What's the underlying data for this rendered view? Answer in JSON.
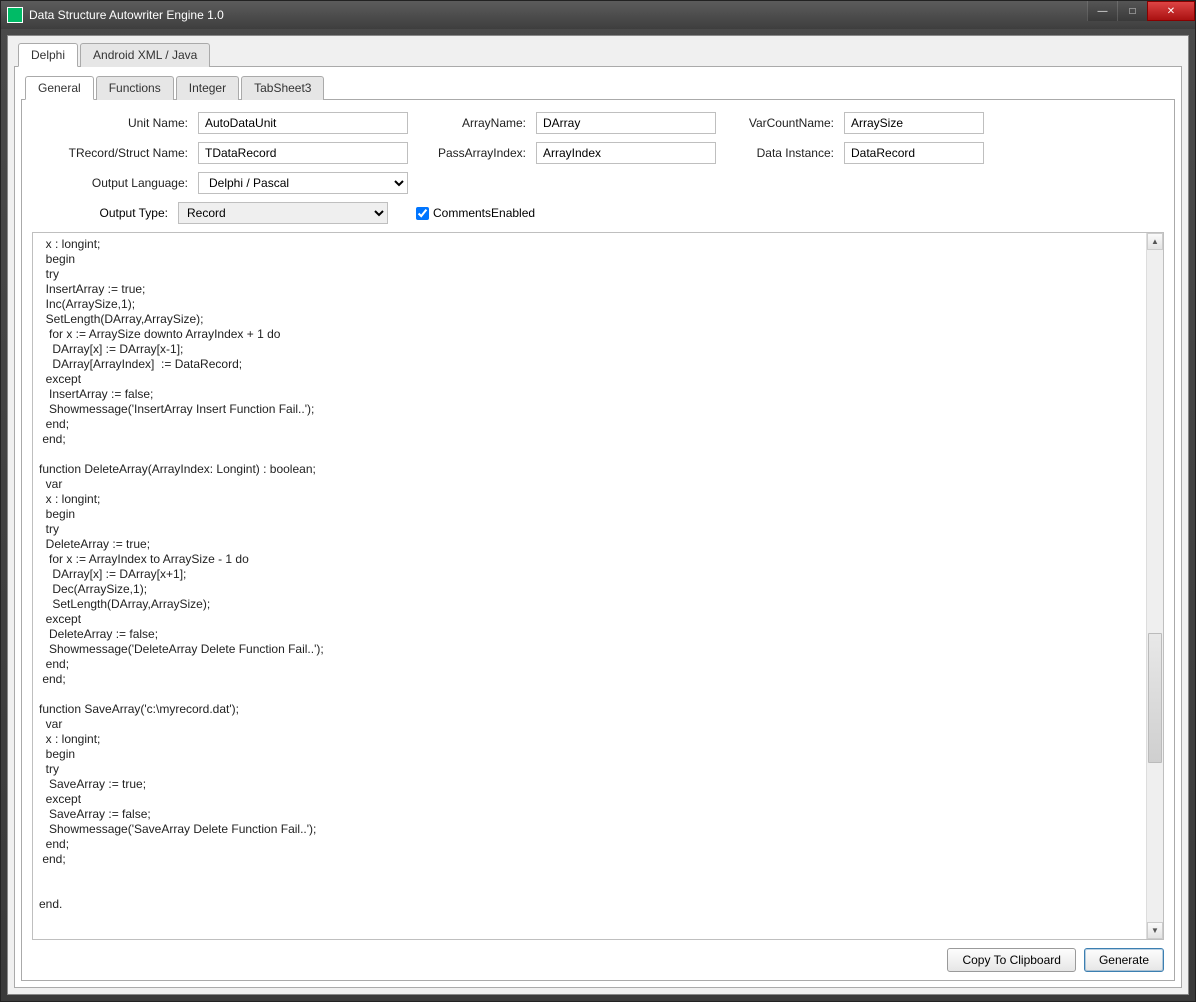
{
  "window": {
    "title": "Data Structure Autowriter Engine 1.0"
  },
  "outerTabs": {
    "delphi": "Delphi",
    "android": "Android XML / Java"
  },
  "innerTabs": {
    "general": "General",
    "functions": "Functions",
    "integer": "Integer",
    "tabsheet3": "TabSheet3"
  },
  "labels": {
    "unitName": "Unit Name:",
    "recordStruct": "TRecord/Struct Name:",
    "outputLang": "Output Language:",
    "outputType": "Output Type:",
    "arrayName": "ArrayName:",
    "passArrayIndex": "PassArrayIndex:",
    "varCountName": "VarCountName:",
    "dataInstance": "Data Instance:",
    "commentsEnabled": "CommentsEnabled"
  },
  "values": {
    "unitName": "AutoDataUnit",
    "recordStruct": "TDataRecord",
    "outputLang": "Delphi / Pascal",
    "outputType": "Record",
    "arrayName": "DArray",
    "passArrayIndex": "ArrayIndex",
    "varCountName": "ArraySize",
    "dataInstance": "DataRecord",
    "commentsEnabled": true
  },
  "code": "  x : longint;\n  begin\n  try\n  InsertArray := true;\n  Inc(ArraySize,1);\n  SetLength(DArray,ArraySize);\n   for x := ArraySize downto ArrayIndex + 1 do\n    DArray[x] := DArray[x-1];\n    DArray[ArrayIndex]  := DataRecord;\n  except\n   InsertArray := false;\n   Showmessage('InsertArray Insert Function Fail..');\n  end;\n end;\n\nfunction DeleteArray(ArrayIndex: Longint) : boolean;\n  var\n  x : longint;\n  begin\n  try\n  DeleteArray := true;\n   for x := ArrayIndex to ArraySize - 1 do\n    DArray[x] := DArray[x+1];\n    Dec(ArraySize,1);\n    SetLength(DArray,ArraySize);\n  except\n   DeleteArray := false;\n   Showmessage('DeleteArray Delete Function Fail..');\n  end;\n end;\n\nfunction SaveArray('c:\\myrecord.dat');\n  var\n  x : longint;\n  begin\n  try\n   SaveArray := true;\n  except\n   SaveArray := false;\n   Showmessage('SaveArray Delete Function Fail..');\n  end;\n end;\n\n\nend.",
  "buttons": {
    "copy": "Copy To Clipboard",
    "generate": "Generate"
  }
}
